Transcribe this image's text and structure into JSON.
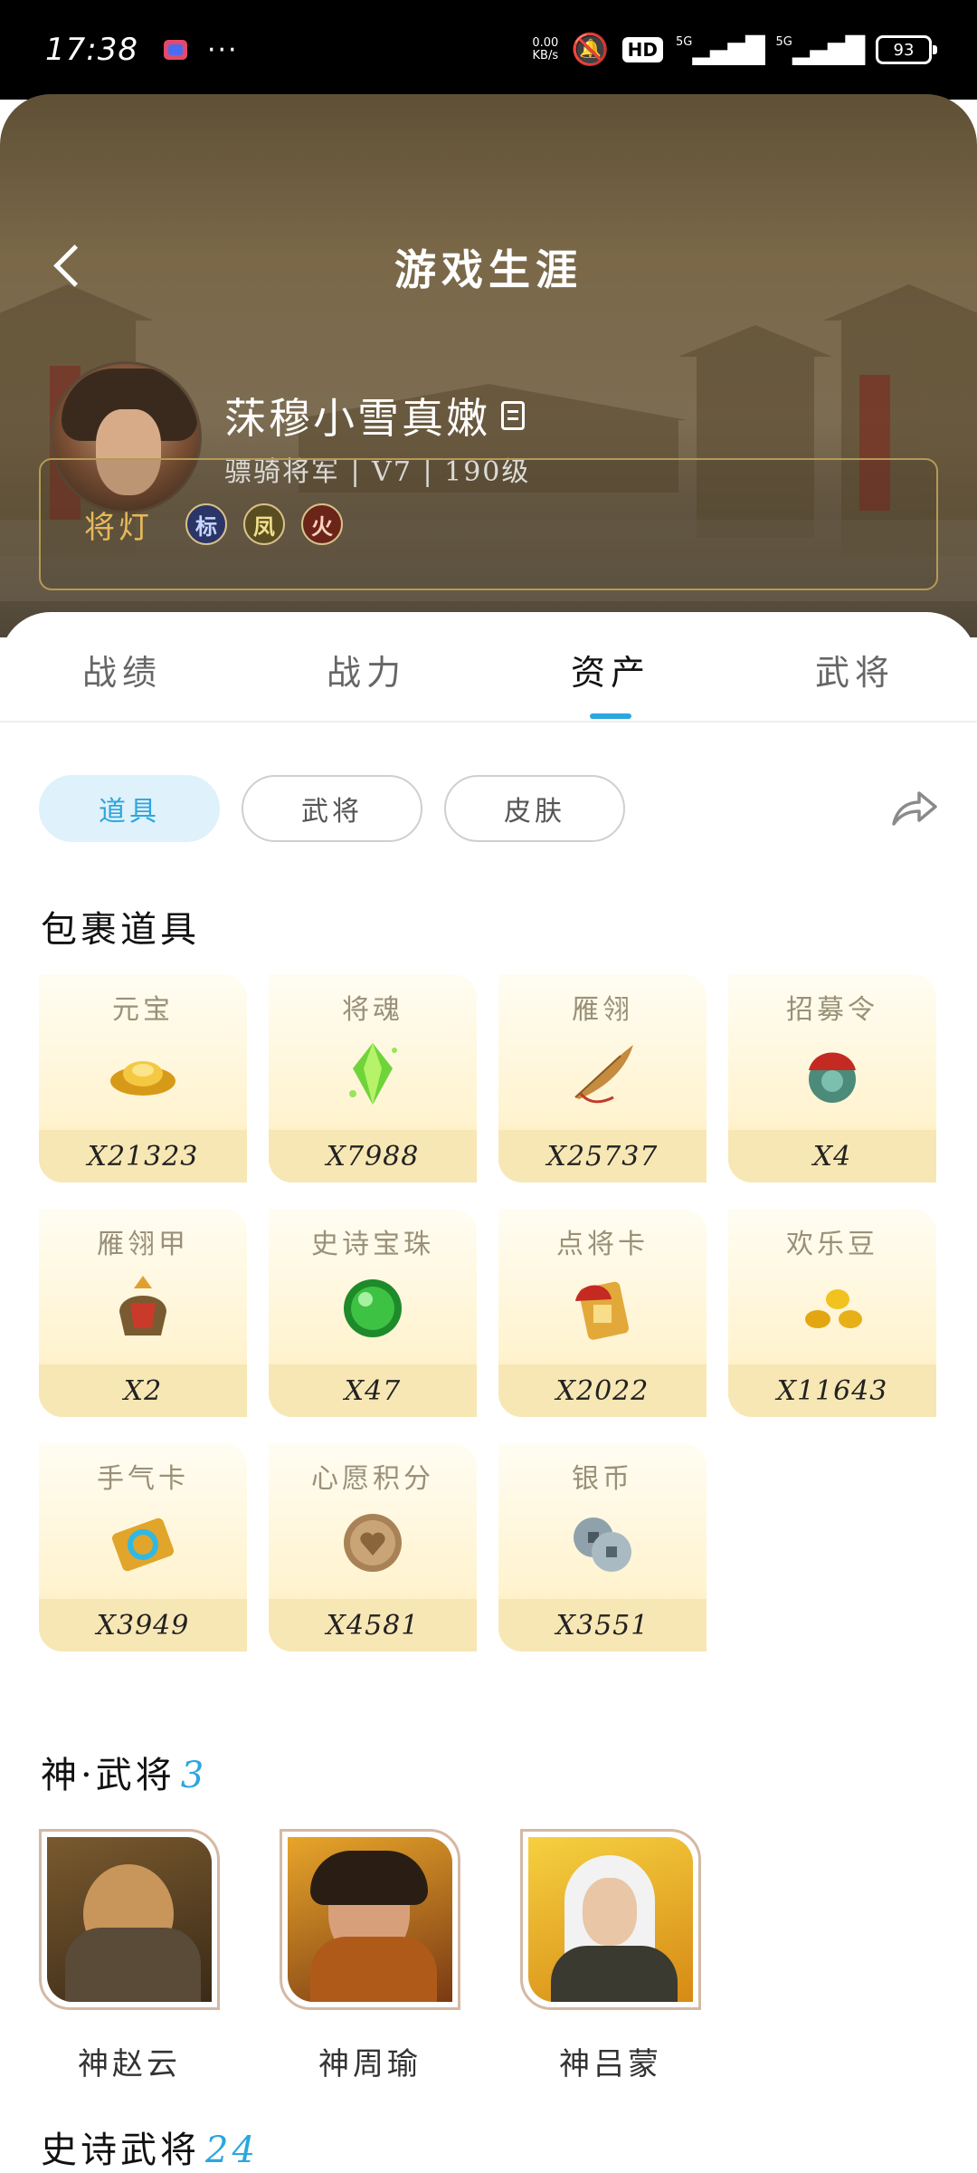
{
  "status_bar": {
    "time": "17:38",
    "net_speed_value": "0.00",
    "net_speed_unit": "KB/s",
    "hd_label": "HD",
    "signal1": "5G",
    "signal2": "5G",
    "battery": "93"
  },
  "header": {
    "title": "游戏生涯",
    "username": "莯穆小雪真嫩",
    "user_info": "骠骑将军 | V7 | 190级"
  },
  "lamps": {
    "label": "将灯",
    "badges": [
      {
        "text": "标",
        "color": "#c9d6ff",
        "bg": "#2b3566"
      },
      {
        "text": "凤",
        "color": "#f0e08a",
        "bg": "#5b4d22"
      },
      {
        "text": "火",
        "color": "#ffd0c0",
        "bg": "#6a2418"
      }
    ]
  },
  "tabs": [
    "战绩",
    "战力",
    "资产",
    "武将"
  ],
  "active_tab": "资产",
  "chips": [
    "道具",
    "武将",
    "皮肤"
  ],
  "active_chip": "道具",
  "bag_section": {
    "title": "包裹道具"
  },
  "items": [
    {
      "name": "元宝",
      "qty": "X21323",
      "icon": "gold-ingot-icon"
    },
    {
      "name": "将魂",
      "qty": "X7988",
      "icon": "green-crystal-icon"
    },
    {
      "name": "雁翎",
      "qty": "X25737",
      "icon": "feather-icon"
    },
    {
      "name": "招募令",
      "qty": "X4",
      "icon": "recruit-token-icon"
    },
    {
      "name": "雁翎甲",
      "qty": "X2",
      "icon": "armor-helmet-icon"
    },
    {
      "name": "史诗宝珠",
      "qty": "X47",
      "icon": "green-orb-icon"
    },
    {
      "name": "点将卡",
      "qty": "X2022",
      "icon": "general-card-icon"
    },
    {
      "name": "欢乐豆",
      "qty": "X11643",
      "icon": "gold-beans-icon"
    },
    {
      "name": "手气卡",
      "qty": "X3949",
      "icon": "luck-card-icon"
    },
    {
      "name": "心愿积分",
      "qty": "X4581",
      "icon": "heart-coin-icon"
    },
    {
      "name": "银币",
      "qty": "X3551",
      "icon": "silver-coins-icon"
    }
  ],
  "divine_section": {
    "title": "神·武将",
    "count": "3"
  },
  "divine_generals": [
    {
      "name": "神赵云"
    },
    {
      "name": "神周瑜"
    },
    {
      "name": "神吕蒙"
    }
  ],
  "epic_section": {
    "title": "史诗武将",
    "count": "24"
  },
  "colors": {
    "accent": "#2ba6de",
    "lamp_gold": "#e8b85a"
  }
}
